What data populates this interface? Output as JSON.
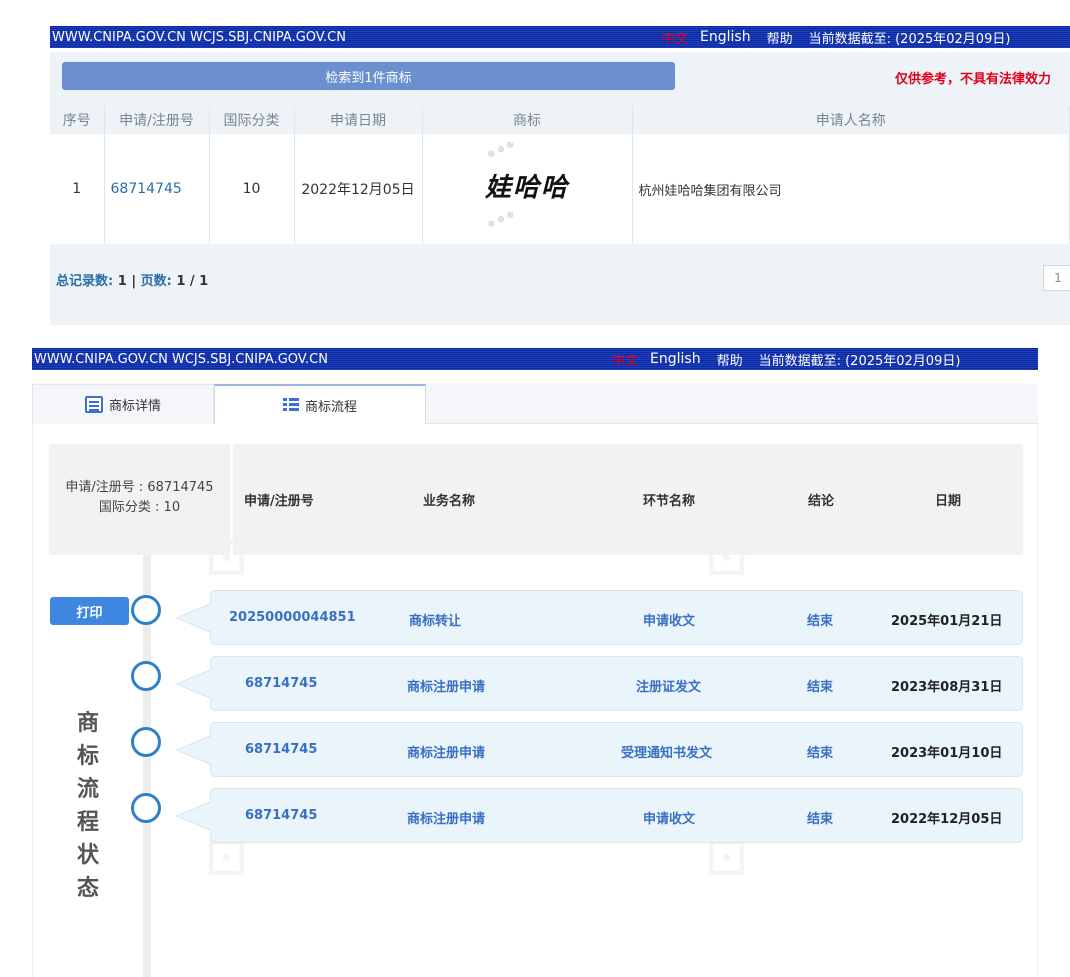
{
  "topbar": {
    "site": "WWW.CNIPA.GOV.CN WCJS.SBJ.CNIPA.GOV.CN",
    "lang_cn": "中文",
    "lang_en": "English",
    "help": "帮助",
    "data_as_of": "当前数据截至: (2025年02月09日)"
  },
  "search": {
    "result_banner": "检索到1件商标",
    "disclaimer": "仅供参考，不具有法律效力",
    "columns": [
      "序号",
      "申请/注册号",
      "国际分类",
      "申请日期",
      "商标",
      "申请人名称"
    ],
    "row": {
      "index": "1",
      "reg_no": "68714745",
      "class": "10",
      "app_date": "2022年12月05日",
      "mark_text": "娃哈哈",
      "applicant": "杭州娃哈哈集团有限公司"
    },
    "pager_total_label": "总记录数:",
    "pager_total": "1",
    "pager_sep": "|",
    "pager_pages_label": "页数:",
    "pager_pages": "1 / 1",
    "page_button": "1"
  },
  "process": {
    "tabs": [
      {
        "label": "商标详情",
        "icon": "detail-icon"
      },
      {
        "label": "商标流程",
        "icon": "flow-icon"
      }
    ],
    "info_line1": "申请/注册号 : 68714745",
    "info_line2": "国际分类 : 10",
    "headers": [
      "申请/注册号",
      "业务名称",
      "环节名称",
      "结论",
      "日期"
    ],
    "print_label": "打印",
    "vertical_label": "商标流程状态",
    "rows": [
      {
        "no": "20250000044851",
        "biz": "商标转让",
        "step": "申请收文",
        "result": "结束",
        "date": "2025年01月21日"
      },
      {
        "no": "68714745",
        "biz": "商标注册申请",
        "step": "注册证发文",
        "result": "结束",
        "date": "2023年08月31日"
      },
      {
        "no": "68714745",
        "biz": "商标注册申请",
        "step": "受理通知书发文",
        "result": "结束",
        "date": "2023年01月10日"
      },
      {
        "no": "68714745",
        "biz": "商标注册申请",
        "step": "申请收文",
        "result": "结束",
        "date": "2022年12月05日"
      }
    ]
  },
  "colors": {
    "topbar": "#1e3fc2",
    "banner": "#6c90cf",
    "disclaimer": "#e0001a",
    "link": "#2a6ea8",
    "print_button": "#3d87e0",
    "card": "#eaf4fb"
  }
}
